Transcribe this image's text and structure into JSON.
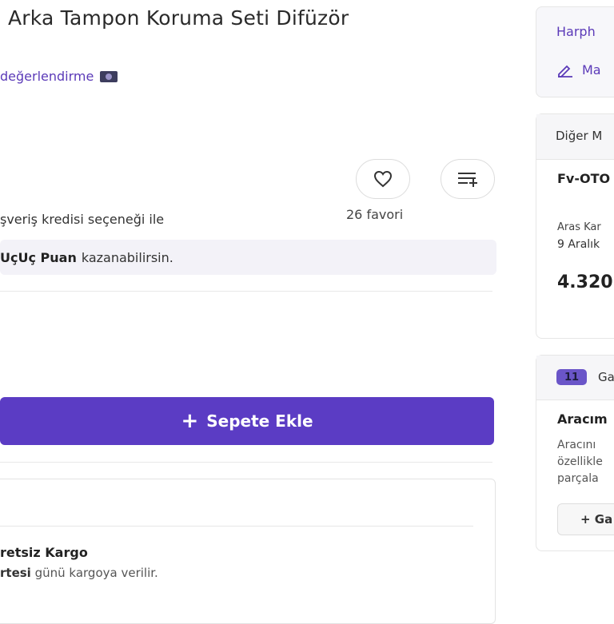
{
  "product": {
    "title": "Arka Tampon Koruma Seti Difüzör",
    "ratings_text": "değerlendirme",
    "credit_text": "şveriş kredisi seçeneği ile",
    "favorites_count": "26 favori",
    "points_bold": "UçUç Puan",
    "points_text": "kazanabilirsin.",
    "add_to_cart": "Sepete Ekle",
    "cargo_title": "retsiz Kargo",
    "cargo_day": "rtesi",
    "cargo_text": "günü kargoya verilir."
  },
  "seller_panel": {
    "name": "Harph",
    "message": "Ma"
  },
  "other_sellers": {
    "title": "Diğer M",
    "seller": "Fv-OTO",
    "shipping": "Aras Kar",
    "date": "9 Aralık",
    "price": "4.320"
  },
  "garage": {
    "icon_label": "11",
    "title": "Ga",
    "subtitle": "Aracım",
    "desc_1": "Aracını",
    "desc_2": "özellikle",
    "desc_3": "parçala",
    "button": "+ Ga"
  },
  "colors": {
    "primary": "#5b3cc4",
    "link": "#5b3ab8"
  }
}
